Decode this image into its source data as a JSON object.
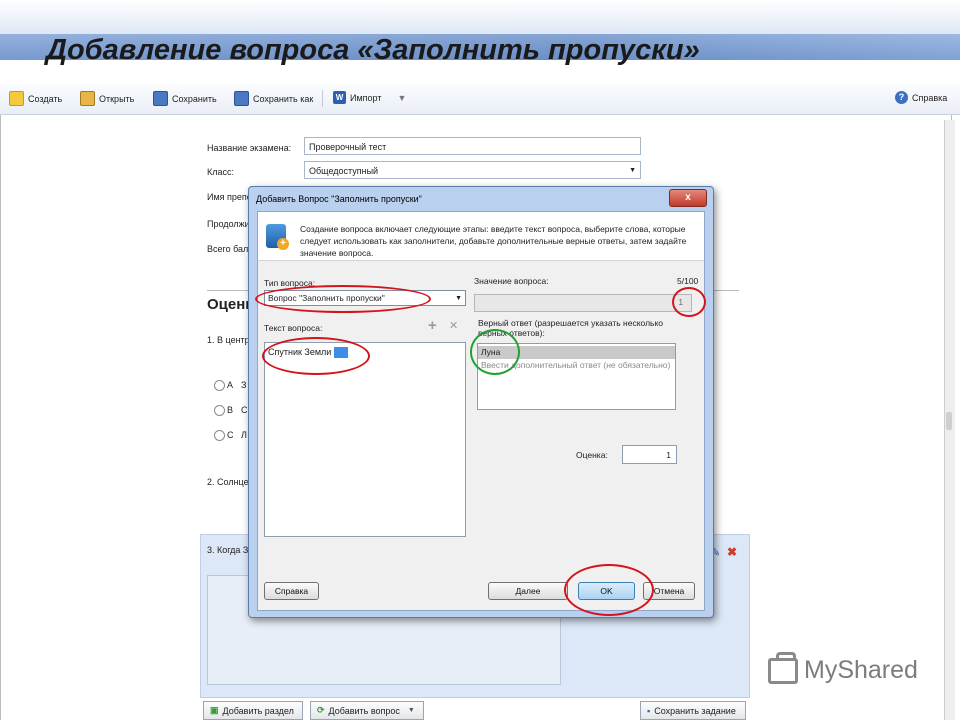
{
  "slide": {
    "title": "Добавление вопроса «Заполнить пропуски»"
  },
  "toolbar": {
    "create": "Создать",
    "open": "Открыть",
    "save": "Сохранить",
    "save_as": "Сохранить как",
    "import": "Импорт",
    "import_icon": "W",
    "help": "Справка",
    "help_icon": "?"
  },
  "form": {
    "exam_name_label": "Название экзамена:",
    "exam_name_value": "Проверочный тест",
    "class_label": "Класс:",
    "class_value": "Общедоступный",
    "teacher_label": "Имя препод",
    "duration_label": "Продолжит",
    "total_label": "Всего балл"
  },
  "background": {
    "section_heading": "Оценк",
    "q1": "1. В центр",
    "options": [
      "A",
      "B",
      "C"
    ],
    "option_stubs": [
      "З",
      "С",
      "Л"
    ],
    "q2": "2. Солнце -",
    "q3": "3. Когда З"
  },
  "bottom_buttons": {
    "add_section": "Добавить раздел",
    "add_question": "Добавить вопрос",
    "save_task": "Сохранить задание"
  },
  "dialog": {
    "title": "Добавить Вопрос \"Заполнить пропуски\"",
    "close": "x",
    "description": "Создание вопроса включает следующие этапы: введите текст вопроса, выберите слова, которые следует использовать как заполнители, добавьте дополнительные верные ответы, затем задайте значение вопроса.",
    "type_label": "Тип вопроса:",
    "type_value": "Вопрос \"Заполнить пропуски\"",
    "text_label": "Текст вопроса:",
    "text_value": "Спутник Земли",
    "add_icon": "+",
    "remove_icon": "✕",
    "value_label": "Значение вопроса:",
    "value_counter": "5/100",
    "value_field": "1",
    "correct_label": "Верный ответ (разрешается указать несколько верных ответов):",
    "answers": [
      "Луна",
      "Ввести дополнительный ответ (не обязательно)"
    ],
    "score_label": "Оценка:",
    "score_value": "1",
    "help_button": "Справка",
    "next_button": "Далее",
    "ok_button": "OK",
    "cancel_button": "Отмена"
  },
  "brand": {
    "name": "MyShared"
  },
  "colors": {
    "highlight_red": "#d4141b",
    "highlight_green": "#22a030",
    "dialog_frame": "#b9d1ee"
  }
}
